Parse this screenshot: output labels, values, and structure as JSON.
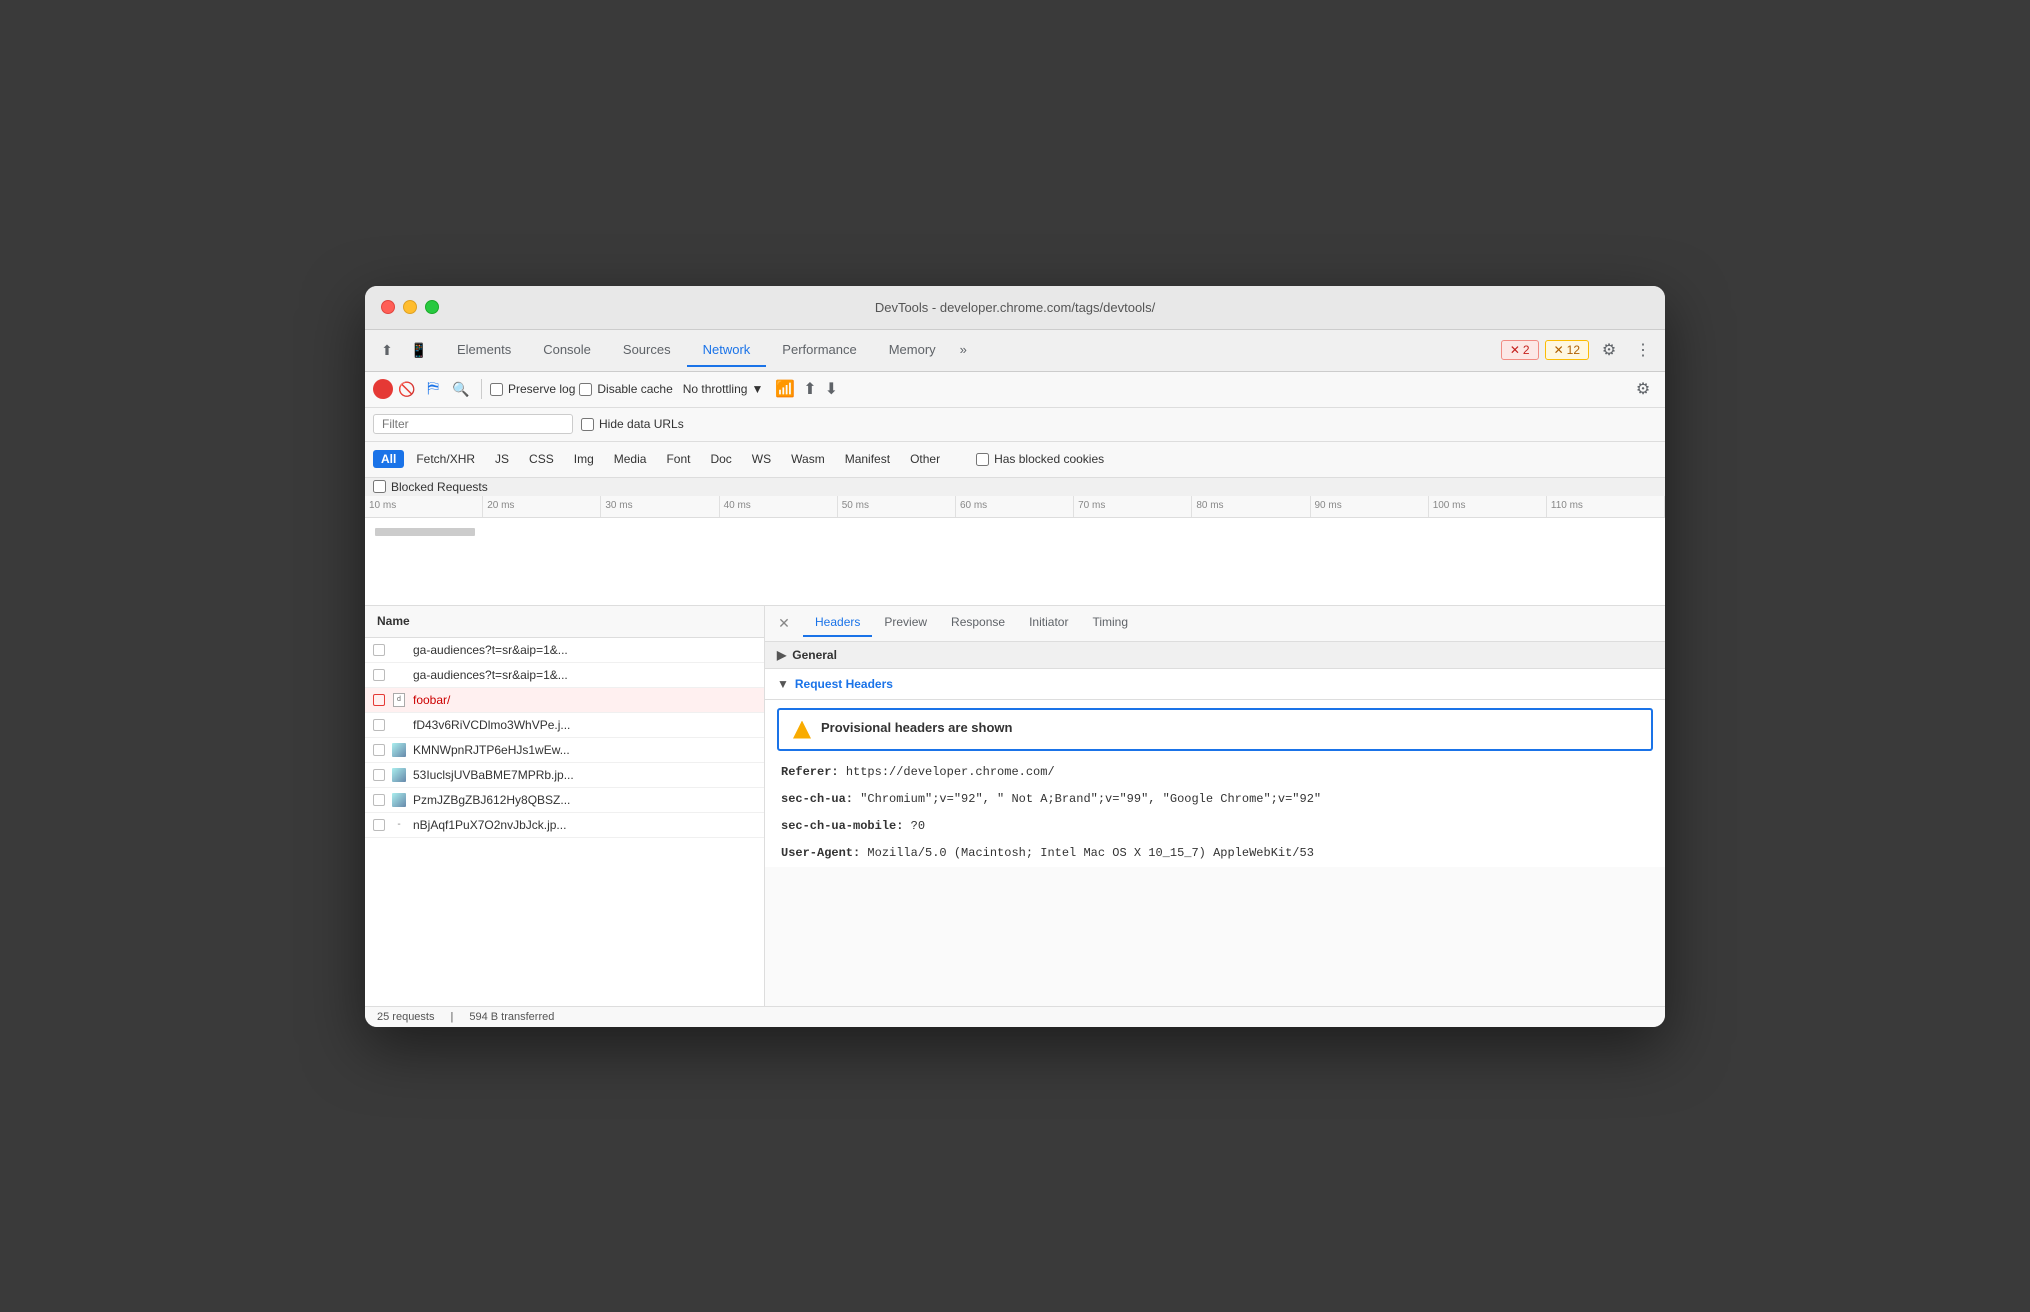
{
  "window": {
    "title": "DevTools - developer.chrome.com/tags/devtools/"
  },
  "tabs": {
    "items": [
      {
        "label": "Elements"
      },
      {
        "label": "Console"
      },
      {
        "label": "Sources"
      },
      {
        "label": "Network"
      },
      {
        "label": "Performance"
      },
      {
        "label": "Memory"
      },
      {
        "label": "»"
      }
    ],
    "active": "Network"
  },
  "badges": {
    "error": {
      "icon": "✕",
      "count": "2"
    },
    "warning": {
      "icon": "✕",
      "count": "12"
    }
  },
  "toolbar": {
    "preserve_log_label": "Preserve log",
    "disable_cache_label": "Disable cache",
    "throttle_label": "No throttling"
  },
  "filter_bar": {
    "placeholder": "Filter",
    "hide_data_urls_label": "Hide data URLs"
  },
  "type_filters": {
    "all_label": "All",
    "items": [
      "Fetch/XHR",
      "JS",
      "CSS",
      "Img",
      "Media",
      "Font",
      "Doc",
      "WS",
      "Wasm",
      "Manifest",
      "Other"
    ]
  },
  "has_blocked_cookies_label": "Has blocked cookies",
  "blocked_requests_label": "Blocked Requests",
  "timeline": {
    "ticks": [
      "10 ms",
      "20 ms",
      "30 ms",
      "40 ms",
      "50 ms",
      "60 ms",
      "70 ms",
      "80 ms",
      "90 ms",
      "100 ms",
      "110 ms"
    ]
  },
  "requests_header": {
    "label": "Name"
  },
  "requests": [
    {
      "name": "ga-audiences?t=sr&aip=1&...",
      "type": "xhr",
      "error": false,
      "selected": false
    },
    {
      "name": "ga-audiences?t=sr&aip=1&...",
      "type": "xhr",
      "error": false,
      "selected": false
    },
    {
      "name": "foobar/",
      "type": "doc",
      "error": true,
      "selected": true
    },
    {
      "name": "fD43v6RiVCDlmo3WhVPe.j...",
      "type": "js",
      "error": false,
      "selected": false
    },
    {
      "name": "KMNWpnRJTP6eHJs1wEw...",
      "type": "img",
      "error": false,
      "selected": false
    },
    {
      "name": "53IuclsjUVBaBME7MPRb.jp...",
      "type": "img",
      "error": false,
      "selected": false
    },
    {
      "name": "PzmJZBgZBJ612Hy8QBSZ...",
      "type": "img",
      "error": false,
      "selected": false
    },
    {
      "name": "nBjAqf1PuX7O2nvJbJck.jp...",
      "type": "img_small",
      "error": false,
      "selected": false
    }
  ],
  "detail_tabs": {
    "items": [
      "Headers",
      "Preview",
      "Response",
      "Initiator",
      "Timing"
    ],
    "active": "Headers"
  },
  "general_section": {
    "label": "General"
  },
  "request_headers_section": {
    "label": "Request Headers",
    "provisional_warning": "Provisional headers are shown",
    "headers": [
      {
        "key": "Referer:",
        "val": "https://developer.chrome.com/"
      },
      {
        "key": "sec-ch-ua:",
        "val": "\"Chromium\";v=\"92\", \" Not A;Brand\";v=\"99\", \"Google Chrome\";v=\"92\""
      },
      {
        "key": "sec-ch-ua-mobile:",
        "val": "?0"
      },
      {
        "key": "User-Agent:",
        "val": "Mozilla/5.0 (Macintosh; Intel Mac OS X 10_15_7) AppleWebKit/53"
      }
    ]
  },
  "status_bar": {
    "requests": "25 requests",
    "transferred": "594 B transferred"
  }
}
